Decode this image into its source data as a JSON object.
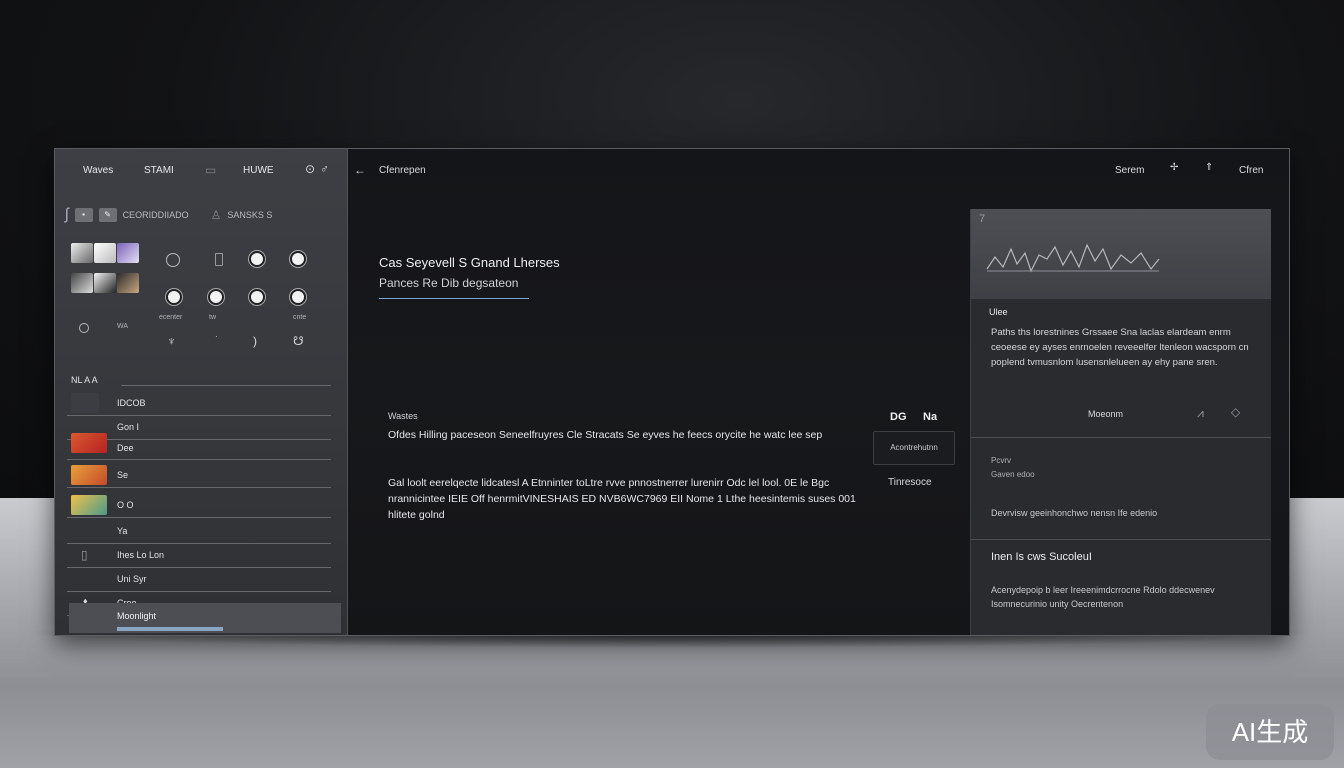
{
  "sidebar": {
    "tabs": [
      "Waves",
      "STAMI",
      "HUWE"
    ],
    "tab_icons": [
      "grid-icon",
      "settings-icon",
      "menu-icon"
    ],
    "section1_label": "CEORIDDIIADO",
    "section1_right": "SANSKS S",
    "grid_labels": [
      "ecenter",
      "tw",
      "cnte"
    ],
    "misc_label": "WA",
    "list_header": "NL A  A",
    "items": [
      {
        "label": "IDCOB"
      },
      {
        "label": "Gon  I"
      },
      {
        "label": "Dee"
      },
      {
        "label": "Se"
      },
      {
        "label": "O  O"
      },
      {
        "label": "Ya"
      },
      {
        "label": "Ihes  Lo Lon"
      },
      {
        "label": "Uni  Syr"
      },
      {
        "label": "Croo"
      },
      {
        "label": "Moonlight"
      }
    ]
  },
  "topbar": {
    "back_icon": "back-arrow-icon",
    "title": "Cfenrepen",
    "right_items": [
      "Serem",
      "Cfren"
    ]
  },
  "main": {
    "heading": "Cas Seyevell S Gnand Lherses",
    "subheading": "Pances  Re Dib degsateon",
    "section_label": "Wastes",
    "paragraph1": "Ofdes Hilling paceseon Seneelfruyres  Cle Stracats Se eyves he feecs  orycite he watc lee sep",
    "paragraph2": "Gal loolt eerelqecte lidcatesl A Etnninter toLtre rvve pnnostnerrer  lurenirr Odc lel lool. 0E le Bgc  nrannicintee IEIE Off henrmitVINESHAIS ED NVB6WC7969  EII Nome  1 Lthe heesintemis  suses 001 hlitete  golnd",
    "col_headers": [
      "DG",
      "Na"
    ],
    "option_button": "Acontrehutnn",
    "option_label": "Tinresoce"
  },
  "right_panel": {
    "title": "Ulee",
    "text": "Paths ths lorestnines Grssaee Sna laclas elardeam enrm ceoeese ey ayses enrnoelen reveeelfer ltenleon  wacsporn cn  poplend  tvmusnlom lusensnlelueen  ay ehy pane sren.",
    "mid_label": "Moeonm",
    "small1": "Pcvrv",
    "small2": "Gaven edoo",
    "body1": "Devrvisw geeinhonchwo nensn Ife edenio",
    "head2": "Inen Is  cws SucoleuI",
    "body2": "Acenydepoip b leer Ireeenimdcrrocne  Rdolo ddecwenev Isomnecurinio  unity Oecrentenon"
  },
  "watermark": "AI生成"
}
